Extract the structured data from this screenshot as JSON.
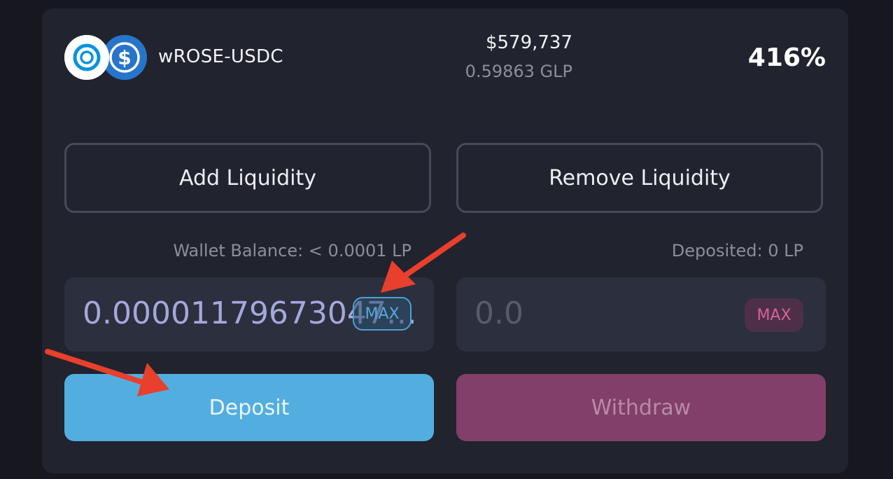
{
  "pool": {
    "name": "wROSE-USDC",
    "tokens": [
      {
        "symbol": "wROSE",
        "icon": "oasis-rose-icon",
        "color": "#ffffff"
      },
      {
        "symbol": "USDC",
        "icon": "usdc-dollar-icon",
        "color": "#2775ca"
      }
    ],
    "tvl": "$579,737",
    "glp_amount": "0.59863 GLP",
    "apr": "416%"
  },
  "tabs": {
    "add_label": "Add Liquidity",
    "remove_label": "Remove Liquidity"
  },
  "deposit_panel": {
    "wallet_balance": "Wallet Balance: < 0.0001 LP",
    "amount_value": "0.000011796730473...",
    "max_label": "MAX",
    "button_label": "Deposit"
  },
  "withdraw_panel": {
    "deposited": "Deposited: 0 LP",
    "amount_placeholder": "0.0",
    "max_label": "MAX",
    "button_label": "Withdraw"
  },
  "colors": {
    "background": "#17171f",
    "card": "#21232e",
    "deposit_accent": "#53aee0",
    "withdraw_accent": "#823f69",
    "annotation_arrow": "#e8402c"
  }
}
